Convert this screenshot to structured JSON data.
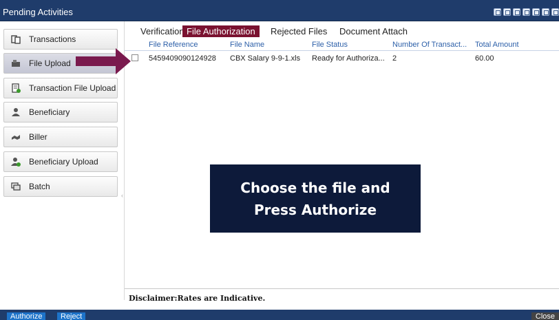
{
  "window": {
    "title": "Pending Activities"
  },
  "sidebar": {
    "items": [
      {
        "label": "Transactions",
        "icon": "transactions-icon",
        "active": false
      },
      {
        "label": "File Upload",
        "icon": "file-upload-icon",
        "active": true
      },
      {
        "label": "Transaction File Upload",
        "icon": "transaction-file-upload-icon",
        "active": false
      },
      {
        "label": "Beneficiary",
        "icon": "beneficiary-icon",
        "active": false
      },
      {
        "label": "Biller",
        "icon": "biller-icon",
        "active": false
      },
      {
        "label": "Beneficiary Upload",
        "icon": "beneficiary-upload-icon",
        "active": false
      },
      {
        "label": "Batch",
        "icon": "batch-icon",
        "active": false
      }
    ]
  },
  "tabs": [
    {
      "label": "Verification",
      "active": false
    },
    {
      "label": "File Authorization",
      "active": true
    },
    {
      "label": "Rejected Files",
      "active": false
    },
    {
      "label": "Document Attach",
      "active": false
    }
  ],
  "grid": {
    "columns": [
      "File Reference",
      "File Name",
      "File Status",
      "Number Of Transact...",
      "Total Amount"
    ],
    "rows": [
      {
        "reference": "5459409090124928",
        "name": "CBX Salary 9-9-1.xls",
        "status": "Ready for Authoriza...",
        "count": "2",
        "amount": "60.00"
      }
    ]
  },
  "callout": {
    "line1": "Choose the file and",
    "line2": "Press Authorize"
  },
  "disclaimer": "Disclaimer:Rates are Indicative.",
  "footer": {
    "authorize": "Authorize",
    "reject": "Reject",
    "close": "Close"
  },
  "colors": {
    "header": "#1f3c6b",
    "active_tab": "#7a1230",
    "arrow": "#7a1a4e",
    "callout": "#0d1a3a",
    "action_button": "#1d73c9"
  }
}
